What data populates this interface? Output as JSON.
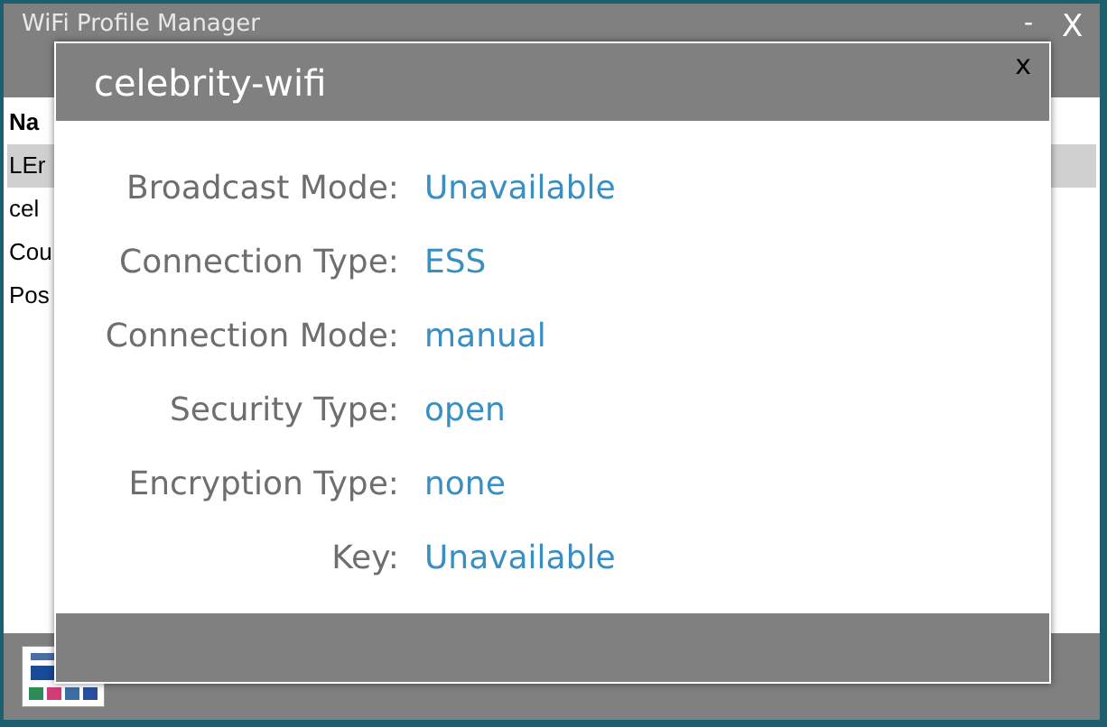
{
  "window": {
    "title": "WiFi Profile Manager",
    "minimize": "-",
    "close": "X"
  },
  "list": {
    "header": "Na",
    "rows": [
      {
        "label": "LEr",
        "selected": true
      },
      {
        "label": "cel",
        "selected": false
      },
      {
        "label": "Cou",
        "selected": false
      },
      {
        "label": "Pos",
        "selected": false
      }
    ]
  },
  "dialog": {
    "title": "celebrity-wifi",
    "close": "x",
    "fields": [
      {
        "label": "Broadcast Mode:",
        "value": "Unavailable"
      },
      {
        "label": "Connection Type:",
        "value": "ESS"
      },
      {
        "label": "Connection Mode:",
        "value": "manual"
      },
      {
        "label": "Security Type:",
        "value": "open"
      },
      {
        "label": "Encryption Type:",
        "value": "none"
      },
      {
        "label": "Key:",
        "value": "Unavailable"
      }
    ]
  }
}
